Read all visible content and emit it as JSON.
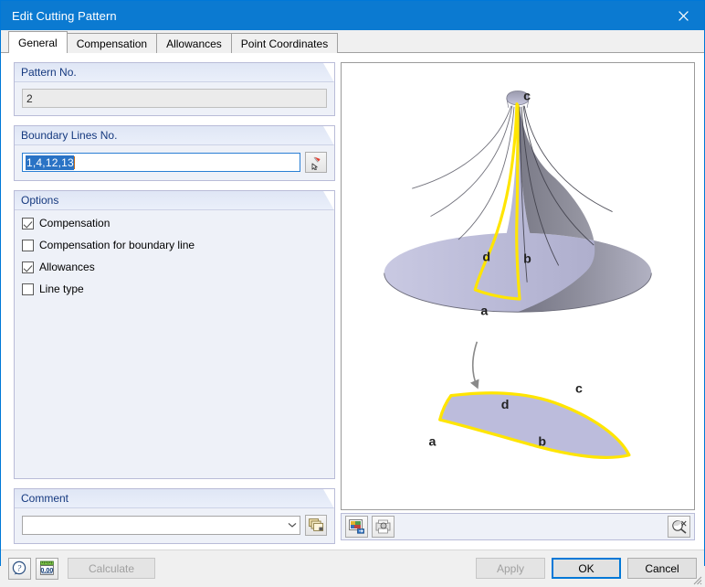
{
  "window": {
    "title": "Edit Cutting Pattern",
    "close_icon": "close-icon"
  },
  "tabs": [
    {
      "label": "General",
      "active": true
    },
    {
      "label": "Compensation",
      "active": false
    },
    {
      "label": "Allowances",
      "active": false
    },
    {
      "label": "Point Coordinates",
      "active": false
    }
  ],
  "pattern_no": {
    "caption": "Pattern No.",
    "value": "2"
  },
  "boundary_lines": {
    "caption": "Boundary Lines No.",
    "value": "1,4,12,13",
    "pick_button_icon": "pick-cursor-icon"
  },
  "options": {
    "caption": "Options",
    "items": [
      {
        "label": "Compensation",
        "checked": true
      },
      {
        "label": "Compensation for boundary line",
        "checked": false
      },
      {
        "label": "Allowances",
        "checked": true
      },
      {
        "label": "Line type",
        "checked": false
      }
    ]
  },
  "comment": {
    "caption": "Comment",
    "value": "",
    "dropdown_icon": "chevron-down-icon",
    "library_button_icon": "copy-layers-icon"
  },
  "graphic": {
    "labels_3d": [
      "c",
      "d",
      "b",
      "a"
    ],
    "labels_flat": [
      "c",
      "d",
      "b",
      "a"
    ],
    "toolbar": {
      "render_button_icon": "render-image-icon",
      "print_preview_button_icon": "print-preview-icon",
      "zoom_button_icon": "zoom-pan-icon"
    },
    "colors": {
      "surface_light": "#bcbcdc",
      "surface_dark": "#8c8c99",
      "highlight": "#ffe500",
      "outline": "#555555"
    }
  },
  "footer": {
    "help_button_icon": "help-icon",
    "units_button_icon": "units-icon",
    "calculate_label": "Calculate",
    "calculate_enabled": false,
    "apply_label": "Apply",
    "apply_enabled": false,
    "ok_label": "OK",
    "cancel_label": "Cancel",
    "resize_grip_icon": "resize-grip-icon"
  }
}
